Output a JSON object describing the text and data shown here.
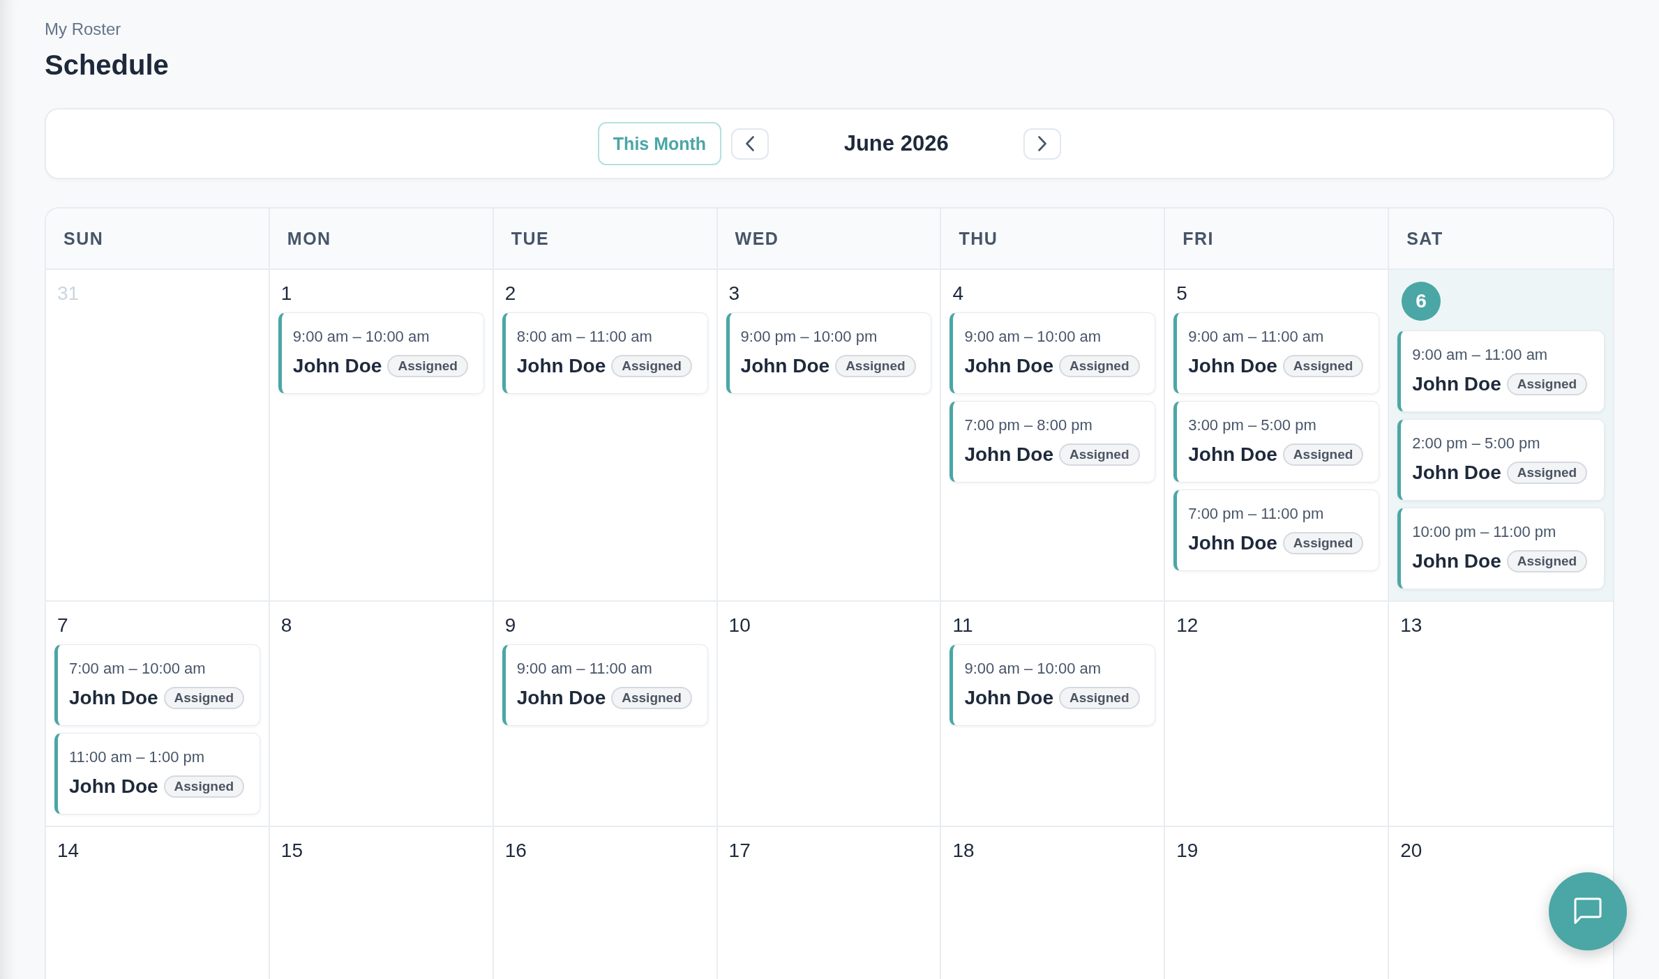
{
  "header": {
    "breadcrumb": "My Roster",
    "title": "Schedule"
  },
  "toolbar": {
    "today_button": "This Month",
    "month_label": "June 2026"
  },
  "calendar": {
    "weekdays": [
      "SUN",
      "MON",
      "TUE",
      "WED",
      "THU",
      "FRI",
      "SAT"
    ],
    "weeks": [
      {
        "days": [
          {
            "date": "31",
            "outside_month": true,
            "today": false
          },
          {
            "date": "1",
            "outside_month": false,
            "today": false,
            "events": [
              {
                "time": "9:00 am – 10:00 am",
                "name": "John Doe",
                "status": "Assigned"
              }
            ]
          },
          {
            "date": "2",
            "outside_month": false,
            "today": false,
            "events": [
              {
                "time": "8:00 am – 11:00 am",
                "name": "John Doe",
                "status": "Assigned"
              }
            ]
          },
          {
            "date": "3",
            "outside_month": false,
            "today": false,
            "events": [
              {
                "time": "9:00 pm – 10:00 pm",
                "name": "John Doe",
                "status": "Assigned"
              }
            ]
          },
          {
            "date": "4",
            "outside_month": false,
            "today": false,
            "events": [
              {
                "time": "9:00 am – 10:00 am",
                "name": "John Doe",
                "status": "Assigned"
              },
              {
                "time": "7:00 pm – 8:00 pm",
                "name": "John Doe",
                "status": "Assigned"
              }
            ]
          },
          {
            "date": "5",
            "outside_month": false,
            "today": false,
            "events": [
              {
                "time": "9:00 am – 11:00 am",
                "name": "John Doe",
                "status": "Assigned"
              },
              {
                "time": "3:00 pm – 5:00 pm",
                "name": "John Doe",
                "status": "Assigned"
              },
              {
                "time": "7:00 pm – 11:00 pm",
                "name": "John Doe",
                "status": "Assigned"
              }
            ]
          },
          {
            "date": "6",
            "outside_month": false,
            "today": true,
            "events": [
              {
                "time": "9:00 am – 11:00 am",
                "name": "John Doe",
                "status": "Assigned"
              },
              {
                "time": "2:00 pm – 5:00 pm",
                "name": "John Doe",
                "status": "Assigned"
              },
              {
                "time": "10:00 pm – 11:00 pm",
                "name": "John Doe",
                "status": "Assigned"
              }
            ]
          }
        ]
      },
      {
        "days": [
          {
            "date": "7",
            "outside_month": false,
            "today": false,
            "events": [
              {
                "time": "7:00 am – 10:00 am",
                "name": "John Doe",
                "status": "Assigned"
              },
              {
                "time": "11:00 am – 1:00 pm",
                "name": "John Doe",
                "status": "Assigned"
              }
            ]
          },
          {
            "date": "8",
            "outside_month": false,
            "today": false
          },
          {
            "date": "9",
            "outside_month": false,
            "today": false,
            "events": [
              {
                "time": "9:00 am – 11:00 am",
                "name": "John Doe",
                "status": "Assigned"
              }
            ]
          },
          {
            "date": "10",
            "outside_month": false,
            "today": false
          },
          {
            "date": "11",
            "outside_month": false,
            "today": false,
            "events": [
              {
                "time": "9:00 am – 10:00 am",
                "name": "John Doe",
                "status": "Assigned"
              }
            ]
          },
          {
            "date": "12",
            "outside_month": false,
            "today": false
          },
          {
            "date": "13",
            "outside_month": false,
            "today": false
          }
        ]
      },
      {
        "days": [
          {
            "date": "14",
            "outside_month": false,
            "today": false
          },
          {
            "date": "15",
            "outside_month": false,
            "today": false
          },
          {
            "date": "16",
            "outside_month": false,
            "today": false
          },
          {
            "date": "17",
            "outside_month": false,
            "today": false
          },
          {
            "date": "18",
            "outside_month": false,
            "today": false
          },
          {
            "date": "19",
            "outside_month": false,
            "today": false
          },
          {
            "date": "20",
            "outside_month": false,
            "today": false
          }
        ]
      }
    ]
  }
}
